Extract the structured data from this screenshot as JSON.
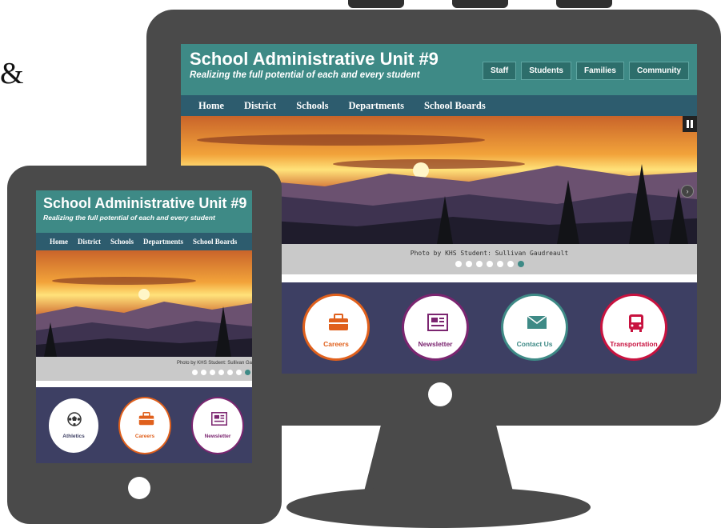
{
  "decor": {
    "ampersand": "&"
  },
  "desktop": {
    "site_title": "School Administrative Unit #9",
    "tagline": "Realizing the full potential of each and every student",
    "quick_links": [
      "Staff",
      "Students",
      "Families",
      "Community"
    ],
    "nav": [
      "Home",
      "District",
      "Schools",
      "Departments",
      "School Boards"
    ],
    "caption": "Photo by KHS Student: Sullivan Gaudreault",
    "slide_count": 7,
    "active_slide": 7,
    "tiles": [
      {
        "label": "Careers",
        "icon": "briefcase-icon",
        "color": "#e0601c"
      },
      {
        "label": "Newsletter",
        "icon": "newspaper-icon",
        "color": "#7b2570"
      },
      {
        "label": "Contact Us",
        "icon": "envelope-icon",
        "color": "#3e8a86"
      },
      {
        "label": "Transportation",
        "icon": "bus-icon",
        "color": "#c8123f"
      }
    ]
  },
  "tablet": {
    "site_title": "School Administrative Unit #9",
    "tagline": "Realizing the full potential of each and every student",
    "nav": [
      "Home",
      "District",
      "Schools",
      "Departments",
      "School Boards"
    ],
    "caption": "Photo by KHS Student: Sullivan Ga",
    "tiles": [
      {
        "label": "Athletics",
        "icon": "soccer-ball-icon",
        "color": "#3d3f63"
      },
      {
        "label": "Careers",
        "icon": "briefcase-icon",
        "color": "#e0601c"
      },
      {
        "label": "Newsletter",
        "icon": "newspaper-icon",
        "color": "#7b2570"
      }
    ]
  },
  "colors": {
    "header_teal": "#3e8a86",
    "nav_dark": "#2d5c6e",
    "tile_band": "#3d3f63",
    "device_frame": "#4a4a4a"
  }
}
